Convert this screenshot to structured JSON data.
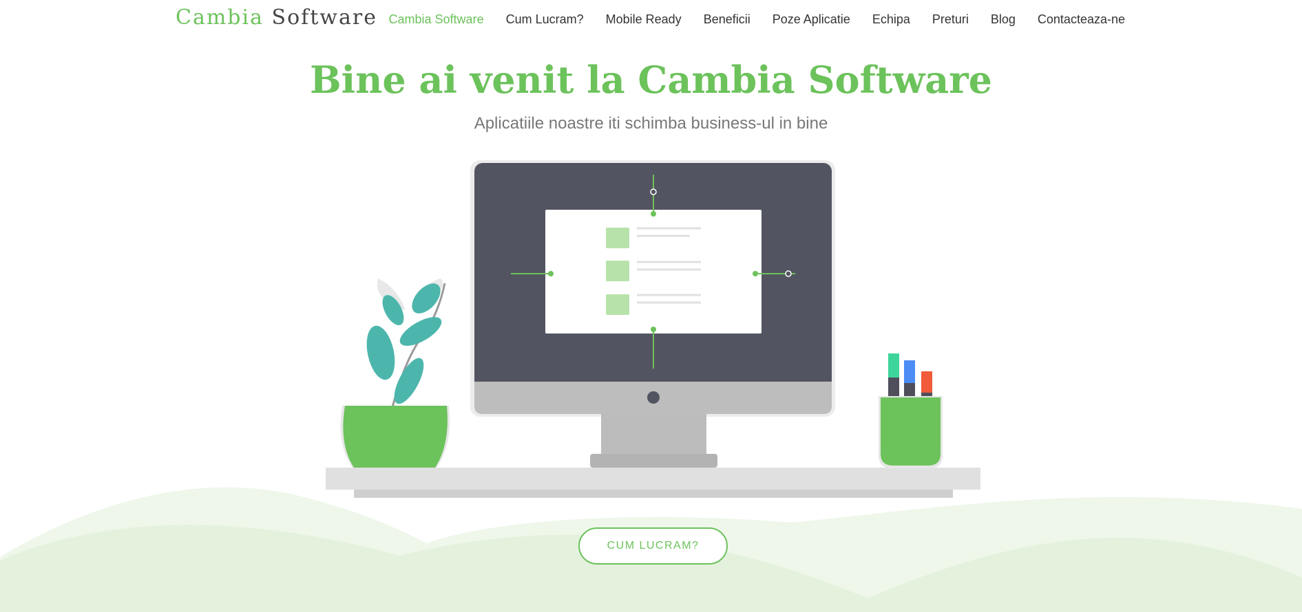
{
  "navbar": {
    "brand_part1": "Cambia",
    "brand_part2": "Software",
    "items": [
      {
        "label": "Cambia Software"
      },
      {
        "label": "Cum Lucram?"
      },
      {
        "label": "Mobile Ready"
      },
      {
        "label": "Beneficii"
      },
      {
        "label": "Poze Aplicatie"
      },
      {
        "label": "Echipa"
      },
      {
        "label": "Preturi"
      },
      {
        "label": "Blog"
      },
      {
        "label": "Contacteaza-ne"
      }
    ],
    "active_item": "Cambia Software"
  },
  "hero": {
    "title": "Bine ai venit la Cambia Software",
    "subtitle": "Aplicatiile noastre iti schimba business-ul in bine",
    "cta_label": "CUM LUCRAM?",
    "illustration_icon": "desk-computer-illustration"
  },
  "colors": {
    "accent": "#6cc25b",
    "text_dark": "#333333",
    "text_muted": "#777777",
    "hill_light": "#e6f3e0",
    "monitor_dark": "#535461",
    "plant_teal": "#4db6ac"
  }
}
